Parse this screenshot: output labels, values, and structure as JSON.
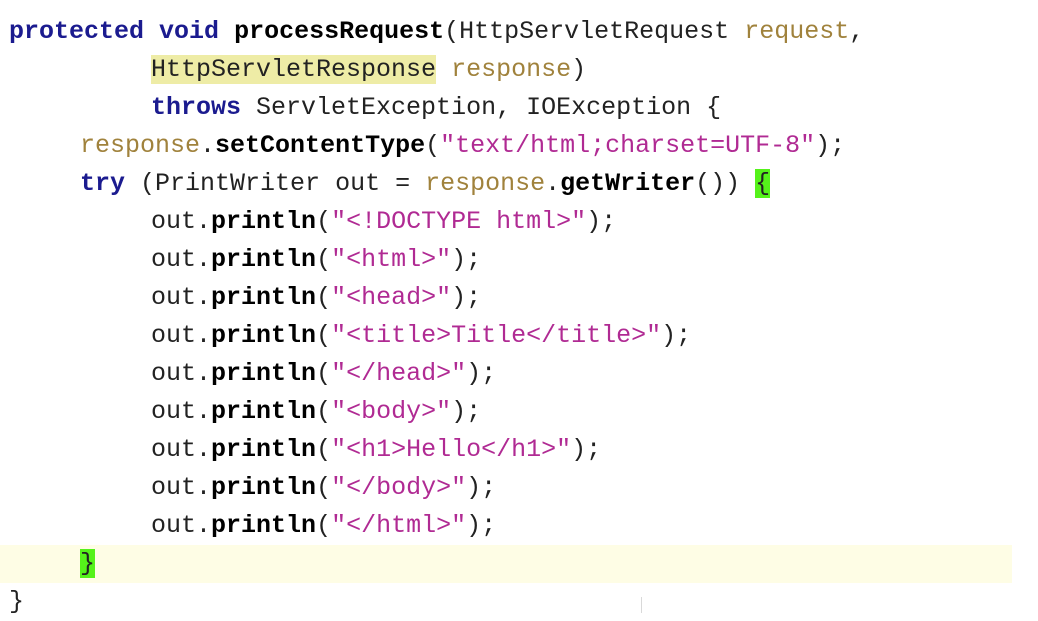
{
  "code": {
    "line1": {
      "kw_protected": "protected",
      "kw_void": "void",
      "method": "processRequest",
      "open": "(",
      "type": "HttpServletRequest",
      "param": "request",
      "comma": ","
    },
    "line2": {
      "type": "HttpServletResponse",
      "param": "response",
      "close": ")"
    },
    "line3": {
      "kw_throws": "throws",
      "exceptions": "ServletException, IOException {"
    },
    "line4": {
      "obj": "response",
      "dot": ".",
      "method": "setContentType",
      "open": "(",
      "string": "\"text/html;charset=UTF-8\"",
      "close": ");"
    },
    "line5": {
      "kw_try": "try",
      "decl": "(PrintWriter out = ",
      "obj": "response",
      "dot": ".",
      "method": "getWriter",
      "close": "()) ",
      "brace": "{"
    },
    "println_lines": [
      {
        "obj": "out",
        "dot": ".",
        "method": "println",
        "open": "(",
        "string": "\"<!DOCTYPE html>\"",
        "close": ");"
      },
      {
        "obj": "out",
        "dot": ".",
        "method": "println",
        "open": "(",
        "string": "\"<html>\"",
        "close": ");"
      },
      {
        "obj": "out",
        "dot": ".",
        "method": "println",
        "open": "(",
        "string": "\"<head>\"",
        "close": ");"
      },
      {
        "obj": "out",
        "dot": ".",
        "method": "println",
        "open": "(",
        "string": "\"<title>Title</title>\"",
        "close": ");"
      },
      {
        "obj": "out",
        "dot": ".",
        "method": "println",
        "open": "(",
        "string": "\"</head>\"",
        "close": ");"
      },
      {
        "obj": "out",
        "dot": ".",
        "method": "println",
        "open": "(",
        "string": "\"<body>\"",
        "close": ");"
      },
      {
        "obj": "out",
        "dot": ".",
        "method": "println",
        "open": "(",
        "string": "\"<h1>Hello</h1>\"",
        "close": ");"
      },
      {
        "obj": "out",
        "dot": ".",
        "method": "println",
        "open": "(",
        "string": "\"</body>\"",
        "close": ");"
      },
      {
        "obj": "out",
        "dot": ".",
        "method": "println",
        "open": "(",
        "string": "\"</html>\"",
        "close": ");"
      }
    ],
    "try_close_brace": "}",
    "method_close_brace": "}"
  },
  "colors": {
    "keyword": "#1b1b8f",
    "string": "#b02a93",
    "parameter": "#a0823c",
    "current_line": "#fefde5",
    "brace_match": "#55f21a",
    "usage_highlight": "#eeeca6"
  }
}
